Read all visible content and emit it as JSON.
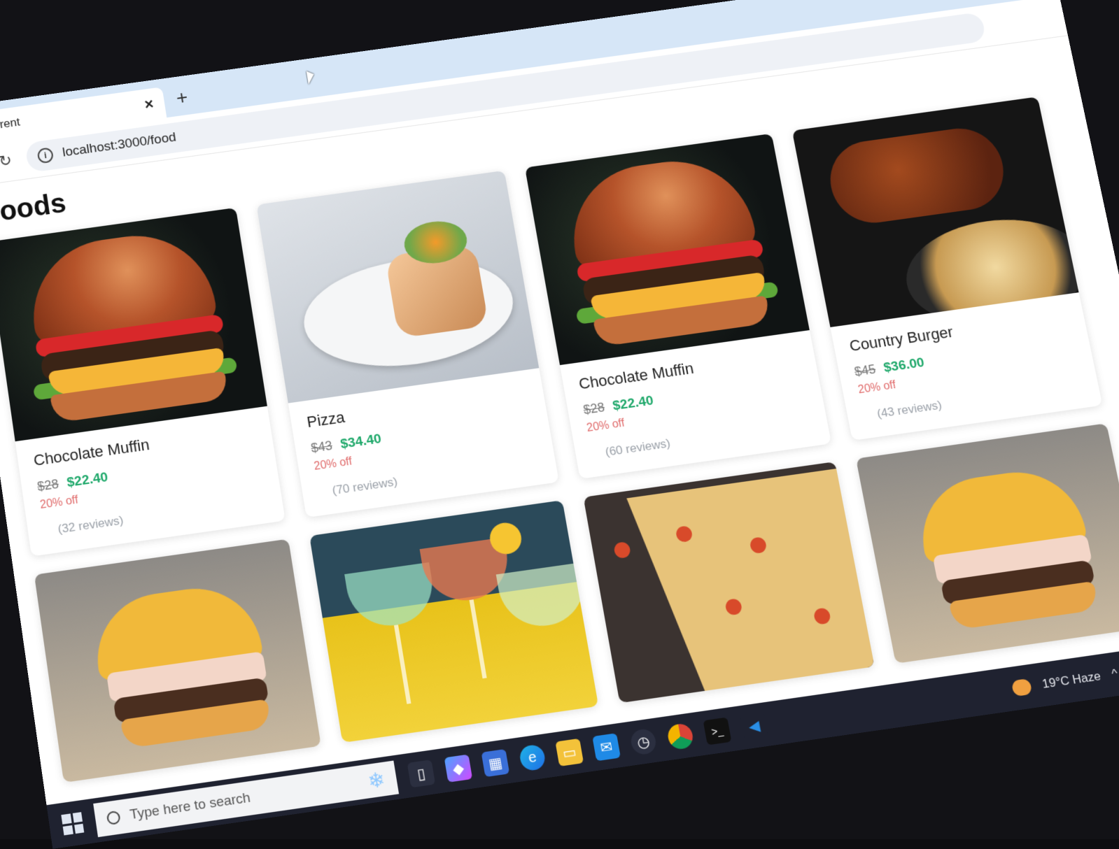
{
  "browser": {
    "tab_title": "Resturent",
    "tab_close": "×",
    "new_tab": "+",
    "url": "localhost:3000/food",
    "info_icon": "i"
  },
  "page": {
    "title": "Foods"
  },
  "foods": [
    {
      "name": "Chocolate Muffin",
      "old_price": "$28",
      "new_price": "$22.40",
      "discount": "20% off",
      "reviews": "(32 reviews)",
      "image": "burger"
    },
    {
      "name": "Pizza",
      "old_price": "$43",
      "new_price": "$34.40",
      "discount": "20% off",
      "reviews": "(70 reviews)",
      "image": "plate"
    },
    {
      "name": "Chocolate Muffin",
      "old_price": "$28",
      "new_price": "$22.40",
      "discount": "20% off",
      "reviews": "(60 reviews)",
      "image": "burger"
    },
    {
      "name": "Country Burger",
      "old_price": "$45",
      "new_price": "$36.00",
      "discount": "20% off",
      "reviews": "(43 reviews)",
      "image": "chicken"
    }
  ],
  "second_row_images": [
    "egg-burger",
    "cocktails",
    "pizza",
    "egg-burger"
  ],
  "taskbar": {
    "search_placeholder": "Type here to search",
    "weather": "19°C  Haze",
    "pinned_icons": [
      "task-view-icon",
      "copilot-icon",
      "store-icon",
      "edge-icon",
      "file-explorer-icon",
      "mail-icon",
      "clock-app-icon",
      "chrome-icon",
      "terminal-icon",
      "vscode-icon"
    ]
  },
  "colors": {
    "price_new": "#1ea86a",
    "discount": "#e06a6a",
    "reviews": "#9aa0a8",
    "tabbar": "#d6e6f7",
    "taskbar": "#1f2230"
  }
}
